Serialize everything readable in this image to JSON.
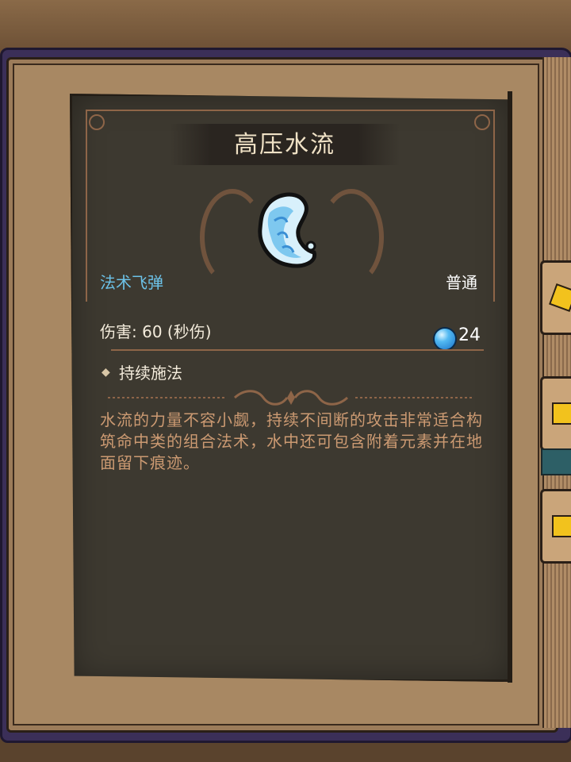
{
  "spell": {
    "title": "高压水流",
    "type": "法术飞弹",
    "rarity": "普通",
    "damage": "伤害: 60 (秒伤)",
    "mana_cost": "24",
    "tag_bullet": "◆",
    "tag": "持续施法",
    "description": "水流的力量不容小觑，持续不间断的攻击非常适合构筑命中类的组合法术，水中还可包含附着元素并在地面留下痕迹。"
  },
  "icons": {
    "spell_icon": "water-stream-icon",
    "mana_icon": "blue-orb-icon",
    "side_tabs": [
      "yellow-cross-tab-icon",
      "yellow-plus-tab-icon",
      "yellow-plus-tab-icon"
    ]
  },
  "colors": {
    "title": "#f0e2c6",
    "spell_type": "#6cc2e8",
    "description": "#cc9a72",
    "panel": "#3d3930",
    "book_cover": "#3b2f58"
  }
}
